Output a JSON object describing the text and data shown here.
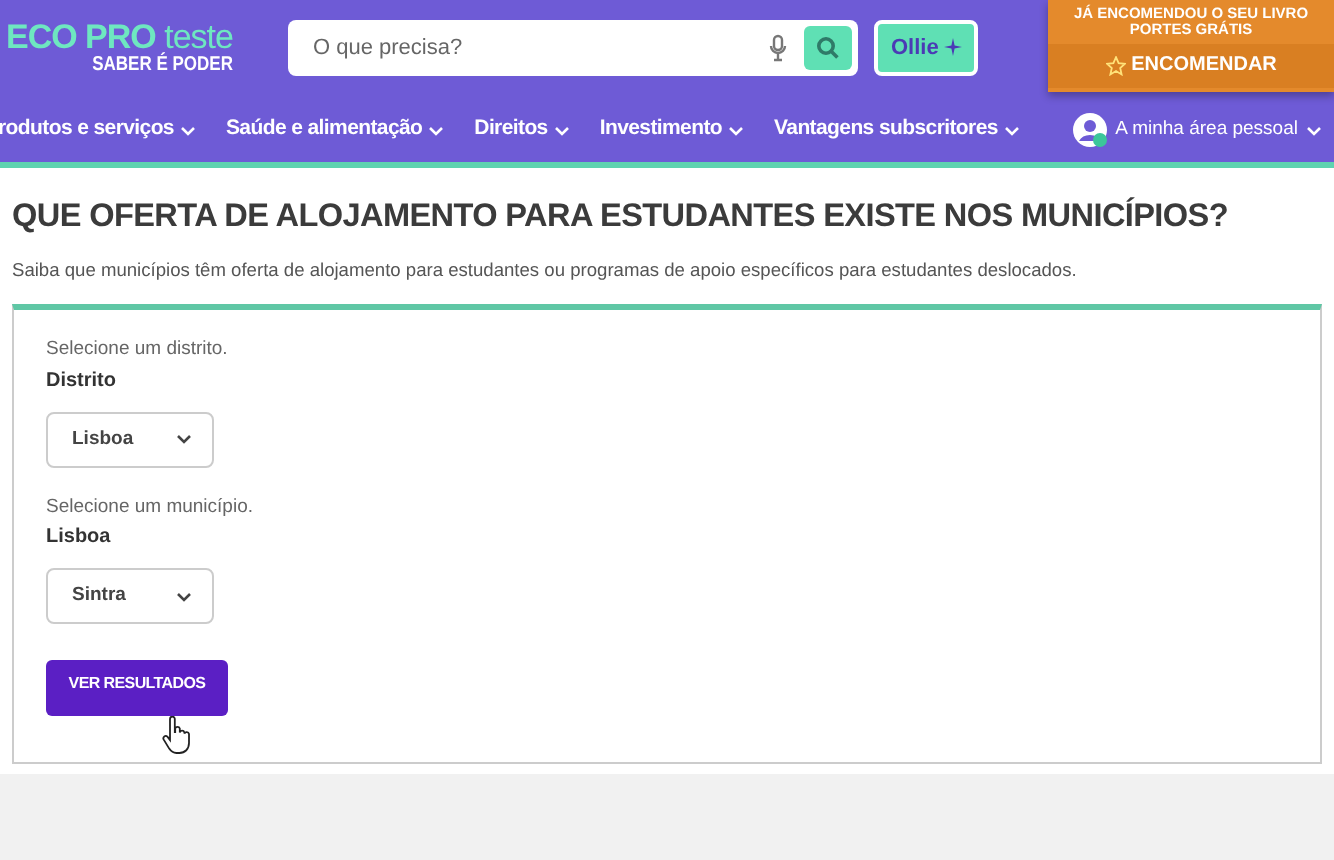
{
  "header": {
    "logo": {
      "brand": "ECO PRO",
      "suffix": "teste",
      "tagline": "SABER É PODER"
    },
    "search": {
      "placeholder": "O que precisa?"
    },
    "assistant_button": "Ollie",
    "promo": {
      "line_1": "JÁ ENCOMENDOU O SEU LIVRO",
      "line_2": "PORTES GRÁTIS",
      "button": "ENCOMENDAR"
    },
    "nav": [
      "rodutos e serviços",
      "Saúde e alimentação",
      "Direitos",
      "Investimento",
      "Vantagens subscritores"
    ],
    "account": "A minha área pessoal"
  },
  "heading": "QUE OFERTA DE ALOJAMENTO PARA ESTUDANTES EXISTE NOS MUNICÍPIOS?",
  "intro": "Saiba que municípios têm oferta de alojamento para estudantes ou programas de apoio específicos para estudantes deslocados.",
  "form": {
    "fields": [
      {
        "hint": "Selecione um distrito.",
        "label": "Distrito",
        "value": "Lisboa"
      },
      {
        "hint": "Selecione um município.",
        "label": "Lisboa",
        "value": "Sintra"
      }
    ],
    "submit": "VER RESULTADOS"
  }
}
